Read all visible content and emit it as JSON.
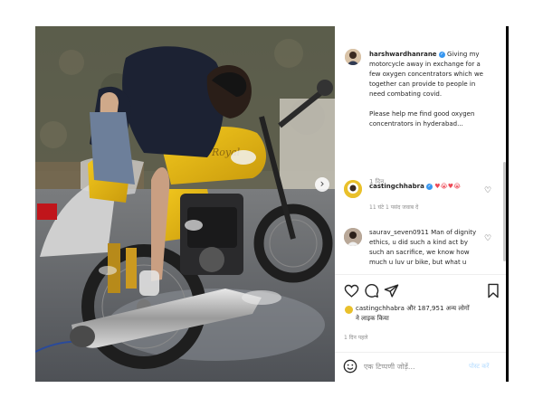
{
  "post": {
    "username": "harshwardhanrane",
    "caption_lines": [
      "Giving my",
      "motorcycle away in exchange for a",
      "few oxygen concentrators which we",
      "together can provide to people in",
      "need combating covid.",
      "",
      "Please help me find good oxygen",
      "concentrators in hyderabad..."
    ],
    "age": "1 दिन"
  },
  "comments": [
    {
      "username": "castingchhabra",
      "text_emojis": "♥😭♥😭",
      "meta": "11 घंटे  1 पसंद  जवाब दें"
    },
    {
      "username": "saurav_seven0911",
      "text_lines": [
        "Man of dignity",
        "ethics, u did such a kind act by",
        "such an sacrifice, we know how",
        "much u luv ur bike, but what u"
      ]
    }
  ],
  "likes": {
    "line1_user": "castingchhabra",
    "line1_rest": " और 187,951 अन्य लोगों",
    "line2": "ने लाइक किया",
    "time": "1 दिन पहले"
  },
  "comment_box": {
    "placeholder": "एक टिप्पणी जोड़ें...",
    "post_label": "पोस्ट करें"
  },
  "carousel": {
    "next_glyph": "›"
  },
  "colors": {
    "link": "#3897f0",
    "like_red": "#ed4956",
    "tank_yellow": "#e2b418"
  },
  "icons": [
    "heart-icon",
    "comment-icon",
    "share-icon",
    "bookmark-icon",
    "emoji-icon",
    "verified-icon",
    "more-icon",
    "chevron-right-icon"
  ]
}
